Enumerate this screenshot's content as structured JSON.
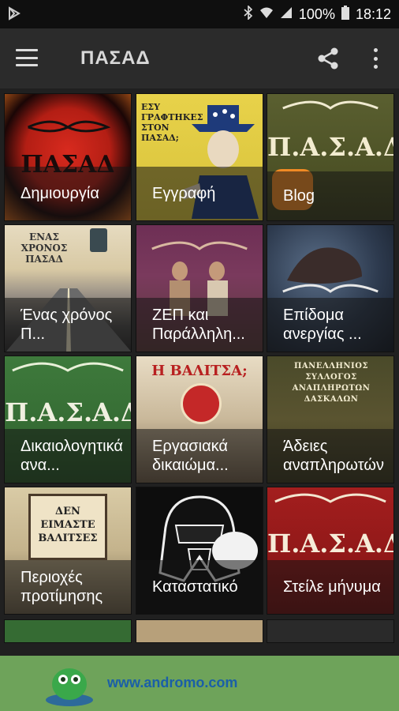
{
  "status_bar": {
    "battery": "100%",
    "time": "18:12"
  },
  "app_bar": {
    "title": "ΠΑΣΑΔ"
  },
  "tiles": [
    {
      "label": "Δημιουργία",
      "art_text": "ΠΑΣΑΔ"
    },
    {
      "label": "Εγγραφή",
      "art_text": "ΕΣΥ ΓΡΑΦΤΗΚΕΣ ΣΤΟΝ ΠΑΣΑΔ;"
    },
    {
      "label": "Blog",
      "art_text": "Π.Α.Σ.Α.Δ"
    },
    {
      "label": "Ένας χρόνος Π...",
      "art_text": "ΕΝΑΣ ΧΡΟΝΟΣ ΠΑΣΑΔ"
    },
    {
      "label": "ΖΕΠ και Παράλληλη...",
      "art_text": ""
    },
    {
      "label": "Επίδομα ανεργίας ...",
      "art_text": ""
    },
    {
      "label": "Δικαιολογητικά ανα...",
      "art_text": "Π.Α.Σ.Α.Δ"
    },
    {
      "label": "Εργασιακά δικαιώμα...",
      "art_text": "Η ΒΑΛΙΤΣΑ;"
    },
    {
      "label": "Άδειες αναπληρωτών",
      "art_text": "ΠΑΝΕΛΛΗΝΙΟΣ ΣΥΛΛΟΓΟΣ ΑΝΑΠΛΗΡΩΤΩΝ ΔΑΣΚΑΛΩΝ"
    },
    {
      "label": "Περιοχές προτίμησης",
      "art_text": "ΔΕΝ ΕΙΜΑΣΤΕ ΒΑΛΙΤΣΕΣ"
    },
    {
      "label": "Καταστατικό",
      "art_text": ""
    },
    {
      "label": "Στείλε μήνυμα",
      "art_text": "Π.Α.Σ.Α.Δ"
    }
  ],
  "ad": {
    "text": "www.andromo.com"
  }
}
